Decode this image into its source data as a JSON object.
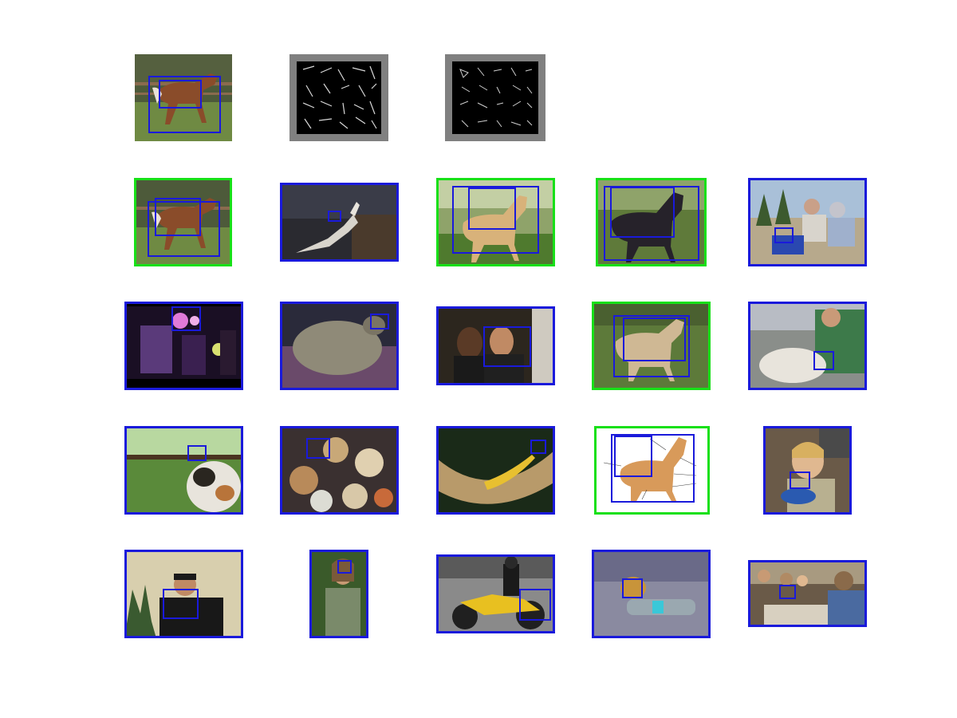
{
  "figure": {
    "title": "",
    "query": {
      "label": "",
      "scene": "horse-paddock"
    },
    "hog_panels": [
      {
        "name": "hog-template-1",
        "label": ""
      },
      {
        "name": "hog-template-2",
        "label": ""
      }
    ],
    "frame_colors": {
      "correct": "#18e018",
      "incorrect": "#1a1adb",
      "box": "#1a1adb"
    },
    "results": [
      {
        "rank": 1,
        "scene": "horse-paddock",
        "correct": true
      },
      {
        "rank": 2,
        "scene": "seagull-flight",
        "correct": false
      },
      {
        "rank": 3,
        "scene": "palomino-horse",
        "correct": true
      },
      {
        "rank": 4,
        "scene": "dark-horse",
        "correct": true
      },
      {
        "rank": 5,
        "scene": "motorbike-riders",
        "correct": false
      },
      {
        "rank": 6,
        "scene": "concert-stage",
        "correct": false
      },
      {
        "rank": 7,
        "scene": "sleeping-cat",
        "correct": false
      },
      {
        "rank": 8,
        "scene": "couple-in-car",
        "correct": false
      },
      {
        "rank": 9,
        "scene": "cream-horse",
        "correct": true
      },
      {
        "rank": 10,
        "scene": "dog-in-car",
        "correct": false
      },
      {
        "rank": 11,
        "scene": "calico-cat",
        "correct": false
      },
      {
        "rank": 12,
        "scene": "food-table",
        "correct": false
      },
      {
        "rank": 13,
        "scene": "hammock",
        "correct": false
      },
      {
        "rank": 14,
        "scene": "horse-diagram",
        "correct": true
      },
      {
        "rank": 15,
        "scene": "girl-eating",
        "correct": false
      },
      {
        "rank": 16,
        "scene": "man-with-camera",
        "correct": false
      },
      {
        "rank": 17,
        "scene": "woman-portrait",
        "correct": false
      },
      {
        "rank": 18,
        "scene": "motorcycle-rider",
        "correct": false
      },
      {
        "rank": 19,
        "scene": "cat-bottle",
        "correct": false
      },
      {
        "rank": 20,
        "scene": "dinner-group",
        "correct": false
      }
    ]
  }
}
